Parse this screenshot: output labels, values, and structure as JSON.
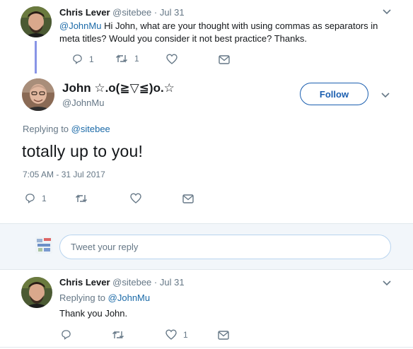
{
  "tweet1": {
    "name": "Chris Lever",
    "handle": "@sitebee",
    "date": "· Jul 31",
    "mention": "@JohnMu",
    "text_line1_rest": " Hi John, what are your thought with using commas as separators in",
    "text_line2": "meta titles? Would you consider it not best practice? Thanks.",
    "reply_count": "1",
    "retweet_count": "1"
  },
  "main": {
    "name": "John ☆.o(≧▽≦)o.☆",
    "handle": "@JohnMu",
    "follow_label": "Follow",
    "replying_prefix": "Replying to ",
    "replying_to": "@sitebee",
    "text": "totally up to you!",
    "timestamp": "7:05 AM - 31 Jul 2017",
    "reply_count": "1"
  },
  "compose": {
    "placeholder": "Tweet your reply"
  },
  "tweet2": {
    "name": "Chris Lever",
    "handle": "@sitebee",
    "date": "· Jul 31",
    "replying_prefix": "Replying to ",
    "replying_to": "@JohnMu",
    "text": "Thank you John.",
    "like_count": "1"
  },
  "colors": {
    "link": "#1b6aa8",
    "muted": "#657786",
    "thread_line": "#8894e6",
    "compose_bg": "#f2f6fa"
  }
}
